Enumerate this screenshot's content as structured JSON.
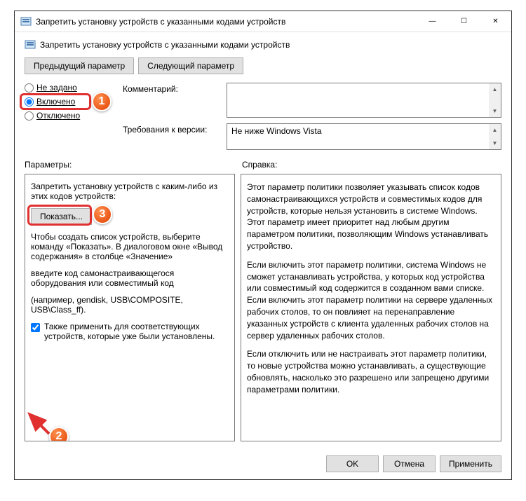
{
  "window": {
    "title": "Запретить установку устройств с указанными кодами устройств"
  },
  "header": {
    "title": "Запретить установку устройств с указанными кодами устройств"
  },
  "nav": {
    "prev": "Предыдущий параметр",
    "next": "Следующий параметр"
  },
  "radios": {
    "not_configured": "Не задано",
    "enabled": "Включено",
    "disabled": "Отключено"
  },
  "labels": {
    "comment": "Комментарий:",
    "requirements": "Требования к версии:",
    "parameters": "Параметры:",
    "help": "Справка:"
  },
  "requirements_text": "Не ниже Windows Vista",
  "params": {
    "desc1": "Запретить установку устройств с каким-либо из этих кодов устройств:",
    "show_btn": "Показать...",
    "desc2": "Чтобы создать список устройств, выберите команду «Показать». В диалоговом окне «Вывод содержания» в столбце «Значение»",
    "desc3": "введите код самонастраивающегося оборудования или совместимый код",
    "desc4": "(например, gendisk, USB\\COMPOSITE, USB\\Class_ff).",
    "checkbox_label": "Также применить для соответствующих устройств, которые уже были установлены."
  },
  "help": {
    "p1": "Этот параметр политики позволяет указывать список кодов самонастраивающихся устройств и совместимых кодов для устройств, которые нельзя установить в системе Windows. Этот параметр имеет приоритет над любым другим параметром политики, позволяющим Windows устанавливать устройство.",
    "p2": "Если включить этот параметр политики, система Windows не сможет устанавливать устройства, у которых код устройства или совместимый код содержится в созданном вами списке. Если включить этот параметр политики на сервере удаленных рабочих столов, то он повлияет на перенаправление указанных устройств с клиента удаленных рабочих столов на сервер удаленных рабочих столов.",
    "p3": "Если отключить или не настраивать этот параметр политики, то новые устройства можно устанавливать, а существующие обновлять, насколько это разрешено или запрещено другими параметрами политики."
  },
  "footer": {
    "ok": "OK",
    "cancel": "Отмена",
    "apply": "Применить"
  },
  "badges": {
    "b1": "1",
    "b2": "2",
    "b3": "3"
  }
}
